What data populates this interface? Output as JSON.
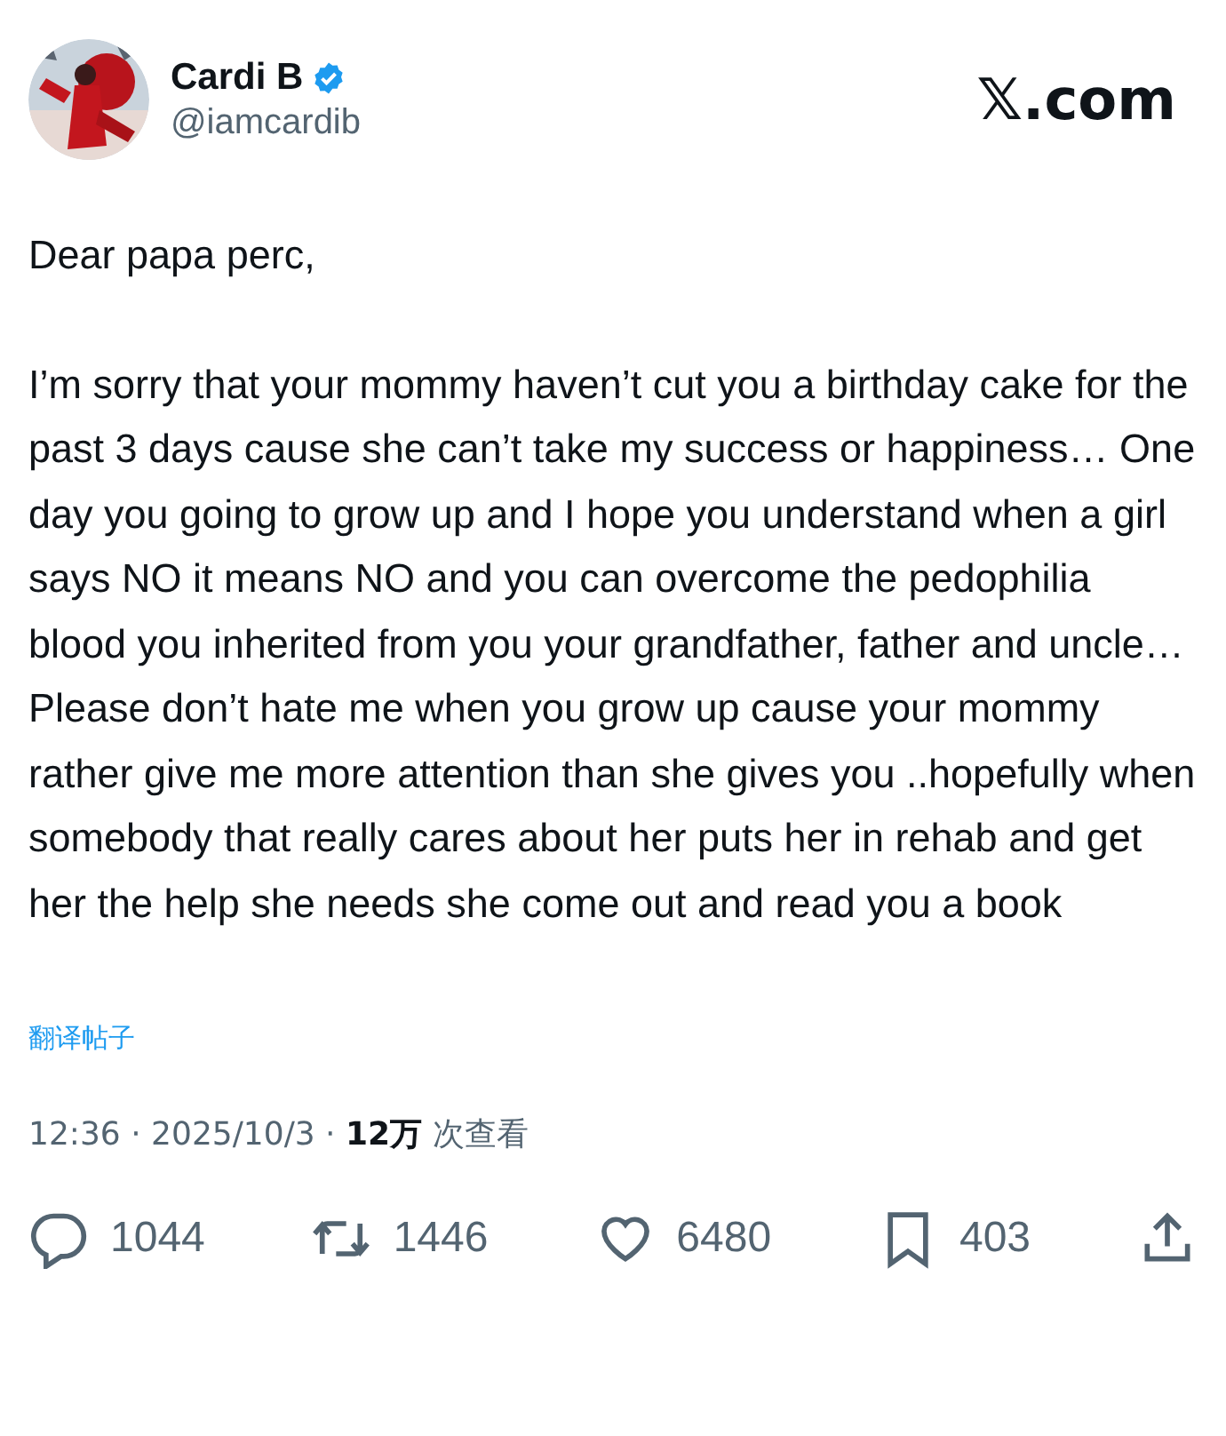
{
  "author": {
    "name": "Cardi B",
    "verified": true,
    "handle": "@iamcardib"
  },
  "site": "𝕏.com",
  "paragraphs": [
    "Dear papa perc,",
    "I’m sorry that your mommy haven’t cut you a birthday cake for the past 3 days cause she can’t take my success or happiness… One day you going to grow up and I hope you understand when a girl says NO it means NO and you can overcome the pedophilia blood you inherited from you your grandfather, father and uncle… Please don’t hate me when you grow up cause your mommy rather give me more attention than she gives you ..hopefully when somebody that really cares about her puts her in rehab and get her the help she needs she come out and read you a book"
  ],
  "translate_link": "翻译帖子",
  "meta": "12:36 · 2025/10/3 · **12万** 次查看",
  "actions": [
    {
      "kind": "reply",
      "count": "1044"
    },
    {
      "kind": "repost",
      "count": "1446"
    },
    {
      "kind": "like",
      "count": "6480"
    },
    {
      "kind": "bookmark",
      "count": "403"
    },
    {
      "kind": "share"
    }
  ]
}
